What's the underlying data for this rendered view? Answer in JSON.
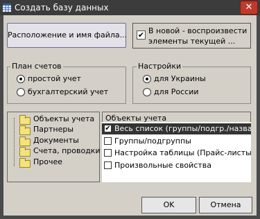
{
  "window": {
    "title": "Создать базу данных",
    "close": "✕"
  },
  "location_button": "Расположение и имя файла...",
  "new_playback": {
    "checked": true,
    "line1": "В новой - воспроизвести",
    "line2": "элементы текущей ..."
  },
  "chart_of_accounts": {
    "title": "План счетов",
    "options": [
      {
        "label": "простой учет",
        "selected": true
      },
      {
        "label": "бухгалтерский учет",
        "selected": false
      }
    ]
  },
  "settings": {
    "title": "Настройки",
    "options": [
      {
        "label": "для Украины",
        "selected": true
      },
      {
        "label": "для России",
        "selected": false
      }
    ]
  },
  "tree": {
    "items": [
      "Объекты учета",
      "Партнеры",
      "Документы",
      "Счета, проводки",
      "Прочее"
    ]
  },
  "objects": {
    "header": "Объекты учета",
    "items": [
      {
        "label": "Весь список (группы/подгр./названия",
        "checked": true,
        "selected": true
      },
      {
        "label": "Группы/подгруппы",
        "checked": false,
        "selected": false
      },
      {
        "label": "Настройка таблицы  (Прайс-листы, С",
        "checked": false,
        "selected": false
      },
      {
        "label": "Произвольные свойства",
        "checked": false,
        "selected": false
      }
    ]
  },
  "buttons": {
    "ok": "OK",
    "cancel": "Отмена"
  },
  "colors": {
    "titlebar": "#3c3c3c",
    "close": "#c0392b",
    "dialog_bg": "#d4d0c8",
    "selection": "#333333"
  }
}
